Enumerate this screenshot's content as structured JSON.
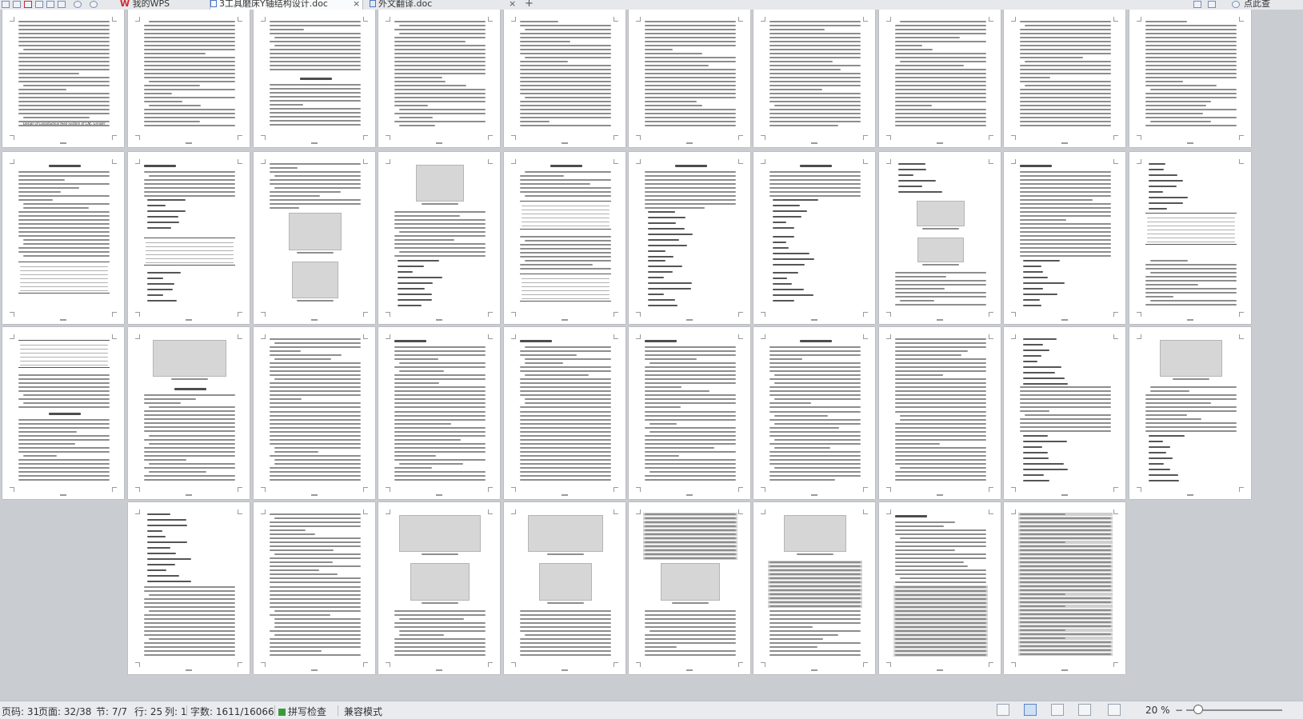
{
  "tabs": [
    {
      "label": "我的WPS",
      "active": false
    },
    {
      "label": "3工具磨床Y轴结构设计.doc",
      "active": true
    },
    {
      "label": "外文翻译.doc",
      "active": false
    }
  ],
  "new_tab_symbol": "+",
  "close_symbol": "×",
  "right_action_label": "点此查",
  "status": {
    "page_code": "页码: 31",
    "page": "页面: 32/38",
    "section": "节: 7/7",
    "row": "行: 25",
    "col": "列: 1",
    "word_count": "字数: 1611/16066",
    "spellcheck": "拼写检查",
    "compat_mode": "兼容模式",
    "zoom": "20 %",
    "zoom_minus": "−"
  },
  "thumbnail_texts": {
    "english_title": "Design of Longitudinal feed System of CNC Grinder",
    "abstract_heading": "摘 要",
    "section_heading": "3 设计计算"
  },
  "colors": {
    "workspace_bg": "#c9ccd1",
    "page_bg": "#ffffff",
    "status_bg": "#e9ebee",
    "spellcheck_ok": "#3a9a3a",
    "wps_logo": "#d0272d",
    "doc_icon": "#4a78c2"
  },
  "icons": [
    "new-doc-icon",
    "open-icon",
    "pdf-icon",
    "save-icon",
    "print-icon",
    "preview-icon",
    "undo-icon",
    "redo-icon",
    "wps-logo-icon",
    "doc-icon",
    "view-icon",
    "zoom-slider-icon"
  ]
}
